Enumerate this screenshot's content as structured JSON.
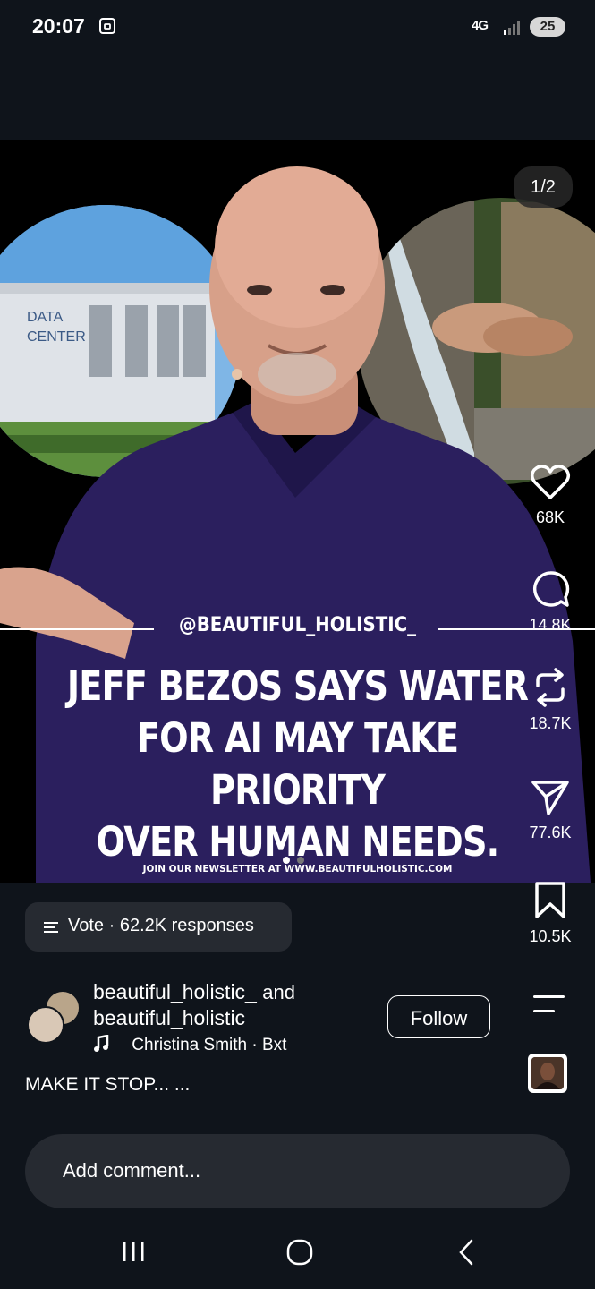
{
  "status_bar": {
    "time": "20:07",
    "network": "4G",
    "battery": "25"
  },
  "post": {
    "image_counter": "1/2",
    "image_label": "DATA\nCENTER",
    "handle_overlay": "@BEAUTIFUL_HOLISTIC_",
    "headline_lines": [
      "JEFF BEZOS SAYS WATER",
      "FOR AI MAY TAKE PRIORITY",
      "OVER HUMAN NEEDS."
    ],
    "newsletter": "JOIN OUR NEWSLETTER AT WWW.BEAUTIFULHOLISTIC.COM",
    "carousel_dots": 2,
    "active_dot": 0
  },
  "actions": {
    "likes": "68K",
    "comments": "14.8K",
    "reposts": "18.7K",
    "shares": "77.6K",
    "saves": "10.5K"
  },
  "vote": {
    "label": "Vote",
    "responses": "62.2K responses"
  },
  "author": {
    "name_1": "beautiful_holistic_",
    "connector": "and",
    "name_2": "beautiful_holistic",
    "audio": "Christina Smith · Bxt",
    "follow_label": "Follow"
  },
  "caption": "MAKE IT STOP... ...",
  "comment_input": {
    "placeholder": "Add comment..."
  },
  "colors": {
    "background": "#0f141b",
    "post_background": "#000000",
    "sweater": "#2b1f5e",
    "chip": "#262a31"
  },
  "icons": [
    "screenshot-icon",
    "signal-icon",
    "heart-icon",
    "comment-icon",
    "repost-icon",
    "share-icon",
    "bookmark-icon",
    "menu-icon",
    "music-note-icon",
    "vote-list-icon",
    "recent-apps-icon",
    "home-icon",
    "back-icon"
  ]
}
